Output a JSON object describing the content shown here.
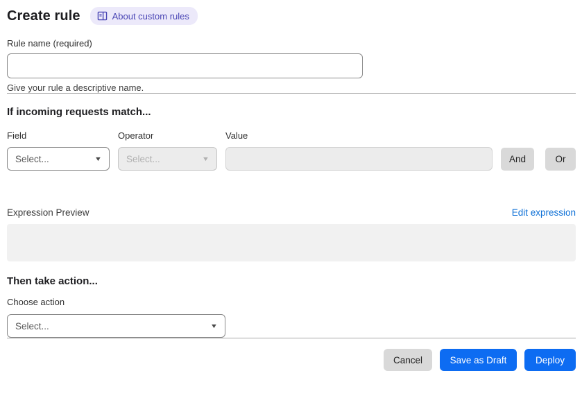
{
  "header": {
    "title": "Create rule",
    "about_link_label": "About custom rules"
  },
  "rule_name": {
    "label": "Rule name (required)",
    "value": "",
    "help": "Give your rule a descriptive name."
  },
  "match": {
    "heading": "If incoming requests match...",
    "field": {
      "label": "Field",
      "selected": "Select..."
    },
    "operator": {
      "label": "Operator",
      "selected": "Select...",
      "disabled": true
    },
    "value": {
      "label": "Value",
      "value": "",
      "disabled": true
    },
    "and_label": "And",
    "or_label": "Or",
    "preview_label": "Expression Preview",
    "edit_link_label": "Edit expression",
    "preview_content": ""
  },
  "action": {
    "heading": "Then take action...",
    "choose_label": "Choose action",
    "selected": "Select..."
  },
  "footer": {
    "cancel_label": "Cancel",
    "save_draft_label": "Save as Draft",
    "deploy_label": "Deploy"
  },
  "colors": {
    "primary_blue": "#0d6cf2",
    "link_blue": "#0c6fd6",
    "badge_bg": "#ece9fa",
    "badge_text": "#4a46b5",
    "disabled_bg": "#ececec",
    "neutral_button_bg": "#d9d9d9",
    "divider": "#a6a6a6"
  }
}
